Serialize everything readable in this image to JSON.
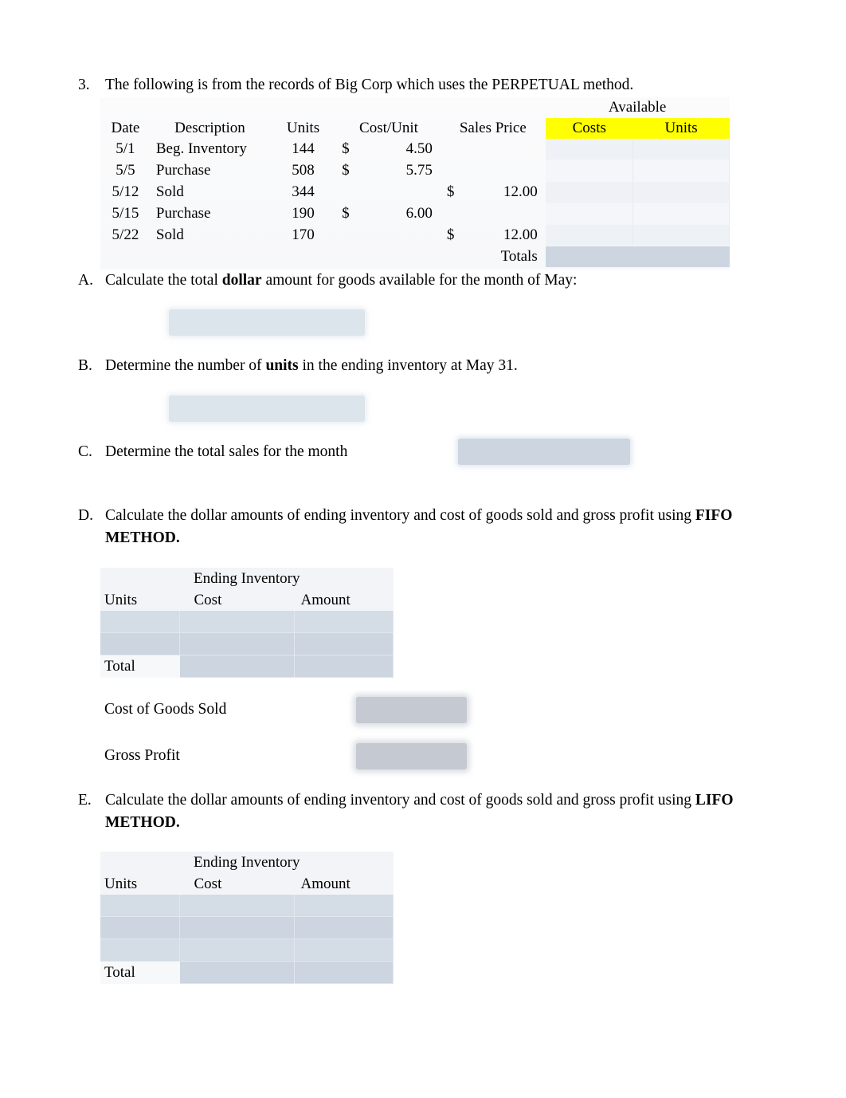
{
  "question": {
    "number": "3.",
    "prompt": "The following is from the records of Big Corp which uses the PERPETUAL method."
  },
  "inventory_table": {
    "group_header": "Available",
    "headers": {
      "date": "Date",
      "description": "Description",
      "units": "Units",
      "cost_unit": "Cost/Unit",
      "sales_price": "Sales Price",
      "available_costs": "Costs",
      "available_units": "Units"
    },
    "highlight_color": "#ffff00",
    "rows": [
      {
        "date": "5/1",
        "description": "Beg. Inventory",
        "units": "144",
        "cost_symbol": "$",
        "cost": "4.50",
        "sales_symbol": "",
        "sales_price": ""
      },
      {
        "date": "5/5",
        "description": "Purchase",
        "units": "508",
        "cost_symbol": "$",
        "cost": "5.75",
        "sales_symbol": "",
        "sales_price": ""
      },
      {
        "date": "5/12",
        "description": "Sold",
        "units": "344",
        "cost_symbol": "",
        "cost": "",
        "sales_symbol": "$",
        "sales_price": "12.00"
      },
      {
        "date": "5/15",
        "description": "Purchase",
        "units": "190",
        "cost_symbol": "$",
        "cost": "6.00",
        "sales_symbol": "",
        "sales_price": ""
      },
      {
        "date": "5/22",
        "description": "Sold",
        "units": "170",
        "cost_symbol": "",
        "cost": "",
        "sales_symbol": "$",
        "sales_price": "12.00"
      }
    ],
    "totals_label": "Totals"
  },
  "parts": {
    "a": {
      "marker": "A.",
      "text_1": "Calculate the total ",
      "bold": "dollar",
      "text_2": " amount for goods available for the month of May:"
    },
    "b": {
      "marker": "B.",
      "text_1": "Determine the number of ",
      "bold": "units",
      "text_2": " in the ending inventory at May 31."
    },
    "c": {
      "marker": "C.",
      "text_1": "Determine the total sales for the month"
    },
    "d": {
      "marker": "D.",
      "text_1": "Calculate the dollar amounts of ending inventory and cost of goods sold and gross profit using ",
      "bold": "FIFO METHOD.",
      "cogs_label": "Cost of Goods Sold",
      "gross_profit_label": "Gross Profit"
    },
    "e": {
      "marker": "E.",
      "text_1": "Calculate the dollar amounts of ending inventory and cost of goods sold and gross profit using ",
      "bold": "LIFO METHOD."
    }
  },
  "ending_inventory": {
    "span_header": "Ending Inventory",
    "col_units": "Units",
    "col_cost": "Cost",
    "col_amount": "Amount",
    "total_label": "Total",
    "fifo_blank_rows": 2,
    "lifo_blank_rows": 3
  },
  "colors": {
    "answer_light": "#dce4ec",
    "answer_mid": "#ccd5e0",
    "answer_dark": "#c4c9d2",
    "highlight": "#ffff00",
    "paper": "#ffffff"
  }
}
